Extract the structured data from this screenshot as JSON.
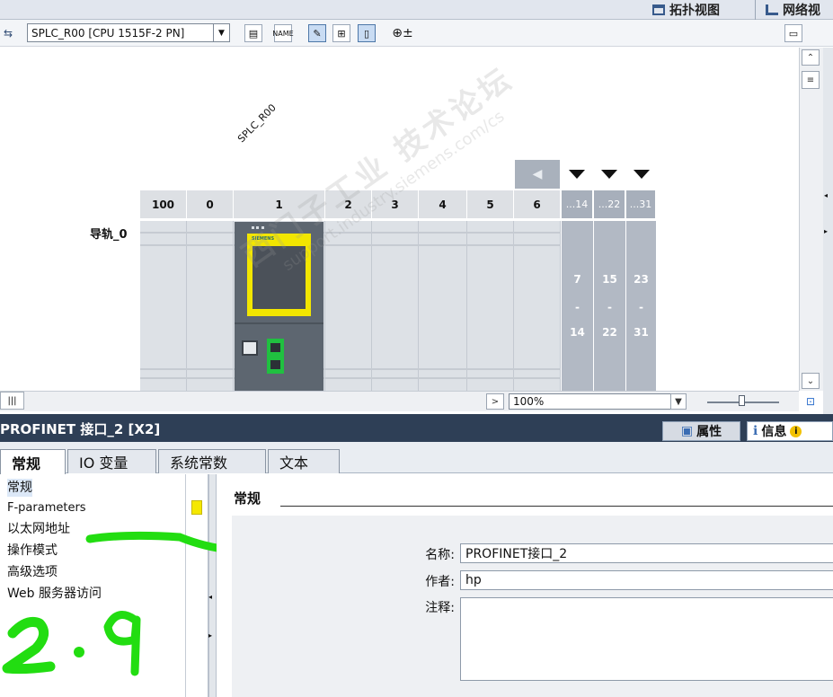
{
  "header": {
    "topology_view": "拓扑视图",
    "network_view": "网络视"
  },
  "toolbar": {
    "device_selector": "SPLC_R00 [CPU 1515F-2 PN]"
  },
  "canvas": {
    "device_label": "SPLC_R00",
    "rail_label": "导轨_0",
    "slot_headers": [
      "100",
      "0",
      "1",
      "2",
      "3",
      "4",
      "5",
      "6"
    ],
    "ext_headers": [
      "...14",
      "...22",
      "...31"
    ],
    "ext_top": [
      "7",
      "15",
      "23"
    ],
    "ext_dash": [
      "-",
      "-",
      "-"
    ],
    "ext_bottom": [
      "14",
      "22",
      "31"
    ],
    "cpu_brand": "SIEMENS"
  },
  "zoom": {
    "value": "100%"
  },
  "properties": {
    "title": "PROFINET 接口_2 [X2]",
    "properties_tab": "属性",
    "info_tab": "信息",
    "tabs": [
      "常规",
      "IO 变量",
      "系统常数",
      "文本"
    ],
    "nav": [
      "常规",
      "F-parameters",
      "以太网地址",
      "操作模式",
      "高级选项",
      "Web 服务器访问"
    ],
    "section_title": "常规",
    "fields": {
      "name_label": "名称:",
      "name_value": "PROFINET接口_2",
      "author_label": "作者:",
      "author_value": "hp",
      "comment_label": "注释:"
    }
  },
  "annotation": {
    "handwritten_text": "2.9"
  },
  "watermark": {
    "line1": "西门子工业 技术论坛",
    "line2": "support.industry.siemens.com/cs"
  },
  "colors": {
    "title_bar": "#2e3f56",
    "cpu_highlight": "#f2e600",
    "port_green": "#20c040",
    "annotation_green": "#22dd11",
    "ext_column": "#b2b9c4"
  }
}
